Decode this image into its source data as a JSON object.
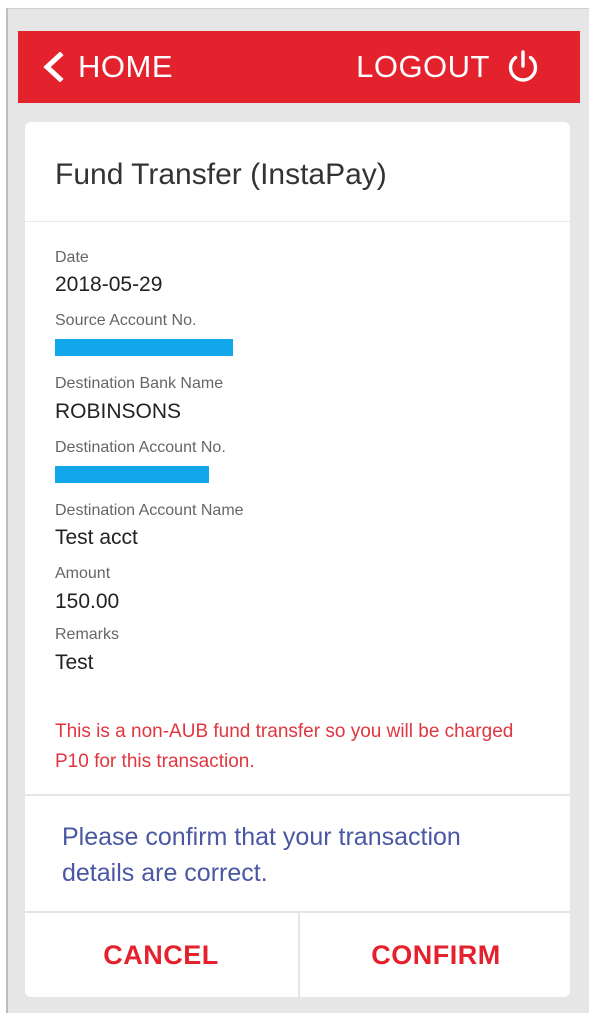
{
  "header": {
    "home_label": "HOME",
    "logout_label": "LOGOUT",
    "bar_color": "#e3222e"
  },
  "title": "Fund Transfer (InstaPay)",
  "fields": {
    "date_label": "Date",
    "date_value": "2018-05-29",
    "source_account_label": "Source Account No.",
    "destination_bank_label": "Destination Bank Name",
    "destination_bank_value": "ROBINSONS",
    "destination_account_label": "Destination Account No.",
    "destination_name_label": "Destination Account Name",
    "destination_name_value": "Test acct",
    "amount_label": "Amount",
    "amount_value": "150.00",
    "remarks_label": "Remarks",
    "remarks_value": "Test",
    "redaction_color": "#12a7ea"
  },
  "warning": "This is a non-AUB fund transfer so you will be charged P10 for this transaction.",
  "confirm_message": "Please confirm that your transaction details are correct.",
  "actions": {
    "cancel_label": "CANCEL",
    "confirm_label": "CONFIRM"
  }
}
